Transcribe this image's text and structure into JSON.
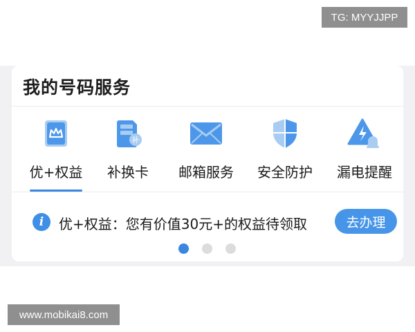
{
  "watermarks": {
    "top": "TG: MYYJJPP",
    "bottom": "www.mobikai8.com"
  },
  "card": {
    "title": "我的号码服务",
    "services": [
      {
        "label": "优+权益",
        "icon": "crown-card-icon",
        "selected": true
      },
      {
        "label": "补换卡",
        "icon": "sim-card-icon",
        "selected": false
      },
      {
        "label": "邮箱服务",
        "icon": "mail-envelope-icon",
        "selected": false
      },
      {
        "label": "安全防护",
        "icon": "shield-icon",
        "selected": false
      },
      {
        "label": "漏电提醒",
        "icon": "alarm-warning-icon",
        "selected": false
      }
    ],
    "notice": {
      "info_icon": "i",
      "text": "优+权益：您有价值30元+的权益待领取",
      "button_label": "去办理"
    },
    "pager": {
      "count": 3,
      "active_index": 0
    }
  },
  "colors": {
    "accent": "#3a86e0",
    "icon_light": "#a9ccf3",
    "button": "#4795e8",
    "page_bg": "#f1f1f4"
  }
}
